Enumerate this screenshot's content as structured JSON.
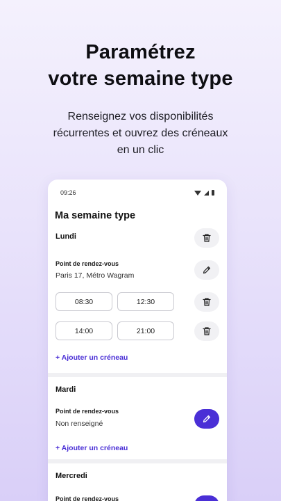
{
  "hero": {
    "title_line1": "Paramétrez",
    "title_line2": "votre semaine type",
    "subtitle_line1": "Renseignez vos disponibilités",
    "subtitle_line2": "récurrentes et ouvrez des créneaux",
    "subtitle_line3": "en un clic"
  },
  "status_bar": {
    "time": "09:26"
  },
  "screen": {
    "title": "Ma semaine type"
  },
  "days": [
    {
      "name": "Lundi",
      "meeting_label": "Point de rendez-vous",
      "meeting_value": "Paris 17, Métro Wagram",
      "slots": [
        {
          "start": "08:30",
          "end": "12:30"
        },
        {
          "start": "14:00",
          "end": "21:00"
        }
      ],
      "add_label": "+ Ajouter un créneau"
    },
    {
      "name": "Mardi",
      "meeting_label": "Point de rendez-vous",
      "meeting_value": "Non renseigné",
      "add_label": "+ Ajouter un créneau"
    },
    {
      "name": "Mercredi",
      "meeting_label": "Point de rendez-vous"
    }
  ],
  "colors": {
    "accent": "#4a2fd6",
    "background_top": "#f4f1fd",
    "background_bottom": "#d9cff8"
  },
  "icons": [
    "trash-icon",
    "pencil-icon",
    "wifi-icon",
    "signal-icon",
    "battery-icon"
  ]
}
